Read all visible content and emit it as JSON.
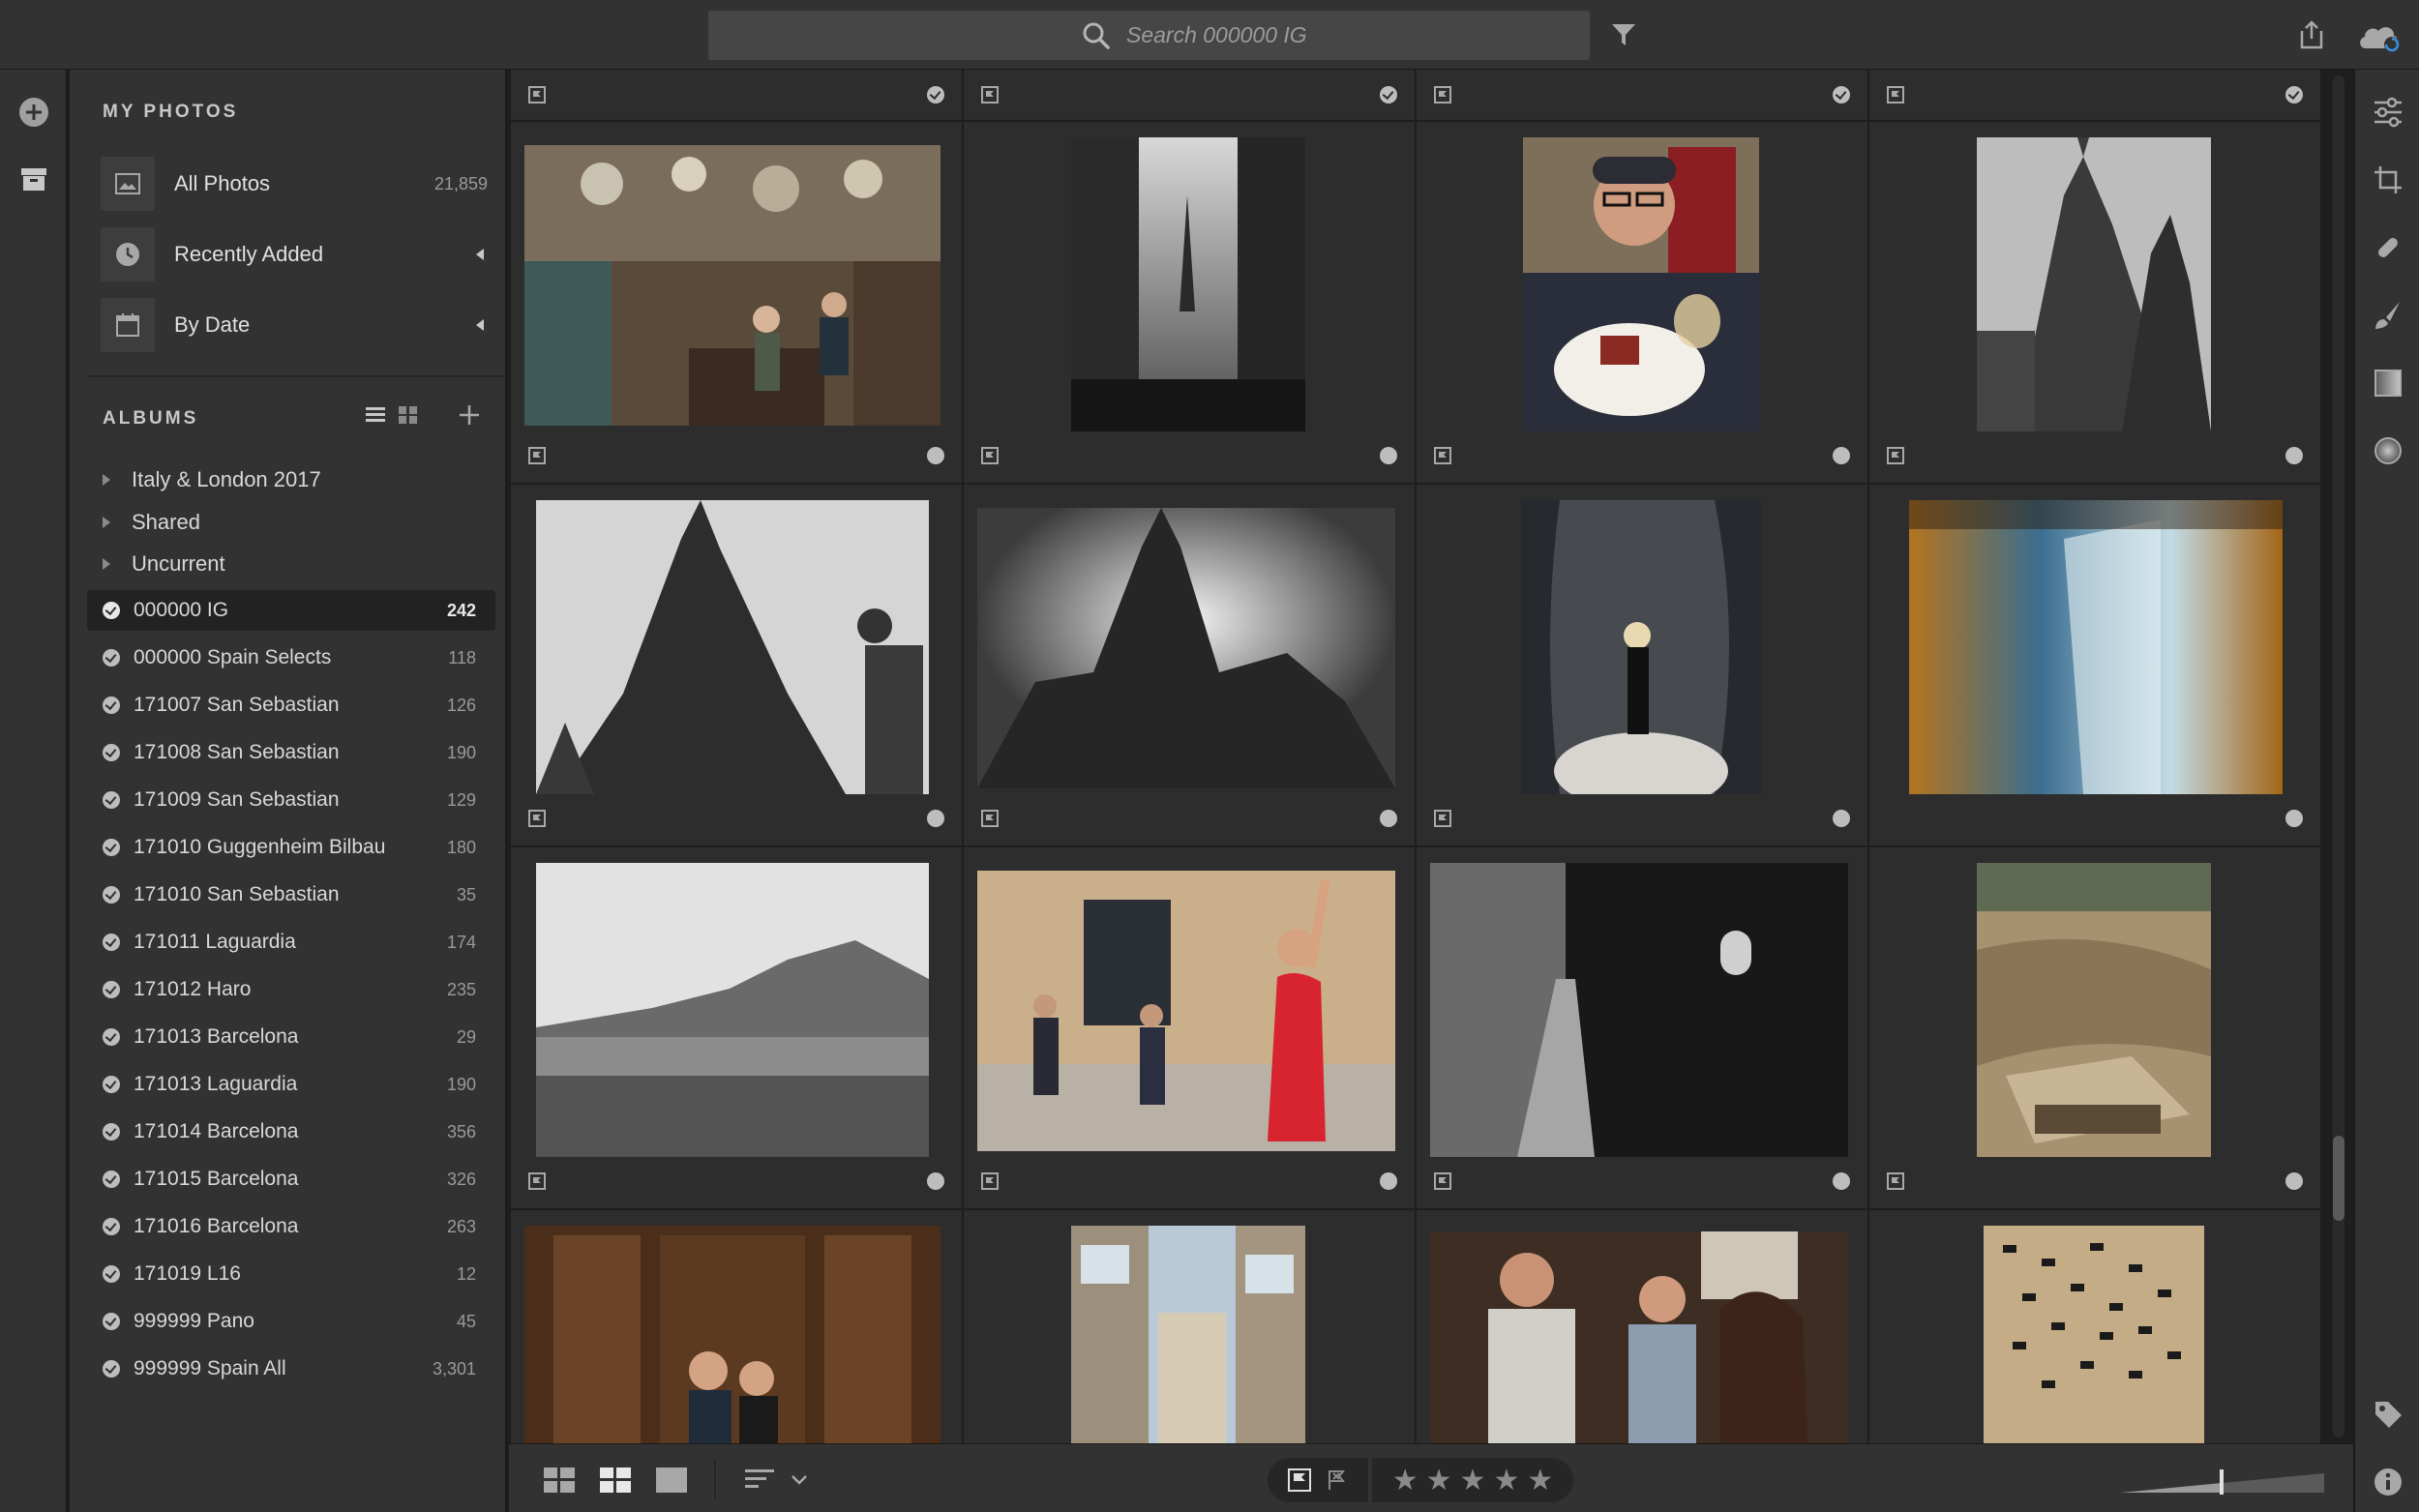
{
  "search": {
    "placeholder": "Search 000000 IG"
  },
  "sidebar": {
    "my_photos_title": "MY PHOTOS",
    "my_photos": [
      {
        "label": "All Photos",
        "count": "21,859"
      },
      {
        "label": "Recently Added",
        "count": ""
      },
      {
        "label": "By Date",
        "count": ""
      }
    ],
    "albums_title": "ALBUMS",
    "folders": [
      {
        "label": "Italy & London 2017"
      },
      {
        "label": "Shared"
      },
      {
        "label": "Uncurrent"
      }
    ],
    "albums": [
      {
        "label": "000000 IG",
        "count": "242",
        "selected": true
      },
      {
        "label": "000000 Spain Selects",
        "count": "118"
      },
      {
        "label": "171007 San Sebastian",
        "count": "126"
      },
      {
        "label": "171008 San Sebastian",
        "count": "190"
      },
      {
        "label": "171009 San Sebastian",
        "count": "129"
      },
      {
        "label": "171010 Guggenheim Bilbau",
        "count": "180"
      },
      {
        "label": "171010 San Sebastian",
        "count": "35"
      },
      {
        "label": "171011 Laguardia",
        "count": "174"
      },
      {
        "label": "171012 Haro",
        "count": "235"
      },
      {
        "label": "171013 Barcelona",
        "count": "29"
      },
      {
        "label": "171013 Laguardia",
        "count": "190"
      },
      {
        "label": "171014 Barcelona",
        "count": "356"
      },
      {
        "label": "171015 Barcelona",
        "count": "326"
      },
      {
        "label": "171016 Barcelona",
        "count": "263"
      },
      {
        "label": "171019 L16",
        "count": "12"
      },
      {
        "label": "999999 Pano",
        "count": "45"
      },
      {
        "label": "999999 Spain All",
        "count": "3,301"
      }
    ]
  },
  "icons": {
    "search": "search-icon",
    "filter": "filter-icon",
    "share": "share-icon",
    "cloud": "cloud-sync-icon",
    "add": "add-icon",
    "archive": "archive-icon",
    "list_view": "list-view-icon",
    "grid_view": "grid-view-icon",
    "edit": "edit-sliders-icon",
    "crop": "crop-icon",
    "healing": "healing-brush-icon",
    "brush": "brush-icon",
    "linear": "linear-gradient-icon",
    "radial": "radial-gradient-icon",
    "tag": "keyword-tag-icon",
    "info": "info-icon"
  },
  "photos": [
    {
      "subject": "crowded shop interior with hanging lamps",
      "row": 0,
      "col": 0
    },
    {
      "subject": "black and white narrow street with spire",
      "row": 0,
      "col": 1
    },
    {
      "subject": "man in cap holding plate and wine glass",
      "row": 0,
      "col": 2
    },
    {
      "subject": "black and white gothic cathedral facade",
      "row": 0,
      "col": 3
    },
    {
      "subject": "black and white cathedral with street lamp",
      "row": 1,
      "col": 0
    },
    {
      "subject": "black and white cathedral against sun",
      "row": 1,
      "col": 1
    },
    {
      "subject": "woman in black dress in curved steel sculpture",
      "row": 1,
      "col": 2
    },
    {
      "subject": "golden and blue abstract elevator interior",
      "row": 1,
      "col": 3
    },
    {
      "subject": "black and white landscape with mountains",
      "row": 2,
      "col": 0
    },
    {
      "subject": "woman in red dress at wedding gathering",
      "row": 2,
      "col": 1
    },
    {
      "subject": "dark alley with arched window",
      "row": 2,
      "col": 2
    },
    {
      "subject": "salt terraces in valley",
      "row": 2,
      "col": 3
    },
    {
      "subject": "couple seated before wooden cabinets",
      "row": 3,
      "col": 0
    },
    {
      "subject": "street with glazed balconies",
      "row": 3,
      "col": 1
    },
    {
      "subject": "man holding dog with two women",
      "row": 3,
      "col": 2
    },
    {
      "subject": "stone wall with dark pattern",
      "row": 3,
      "col": 3
    }
  ],
  "colors": {
    "accent": "#d2d2d2",
    "panel": "#323232",
    "background": "#1e1e1e",
    "selection": "#222222"
  }
}
